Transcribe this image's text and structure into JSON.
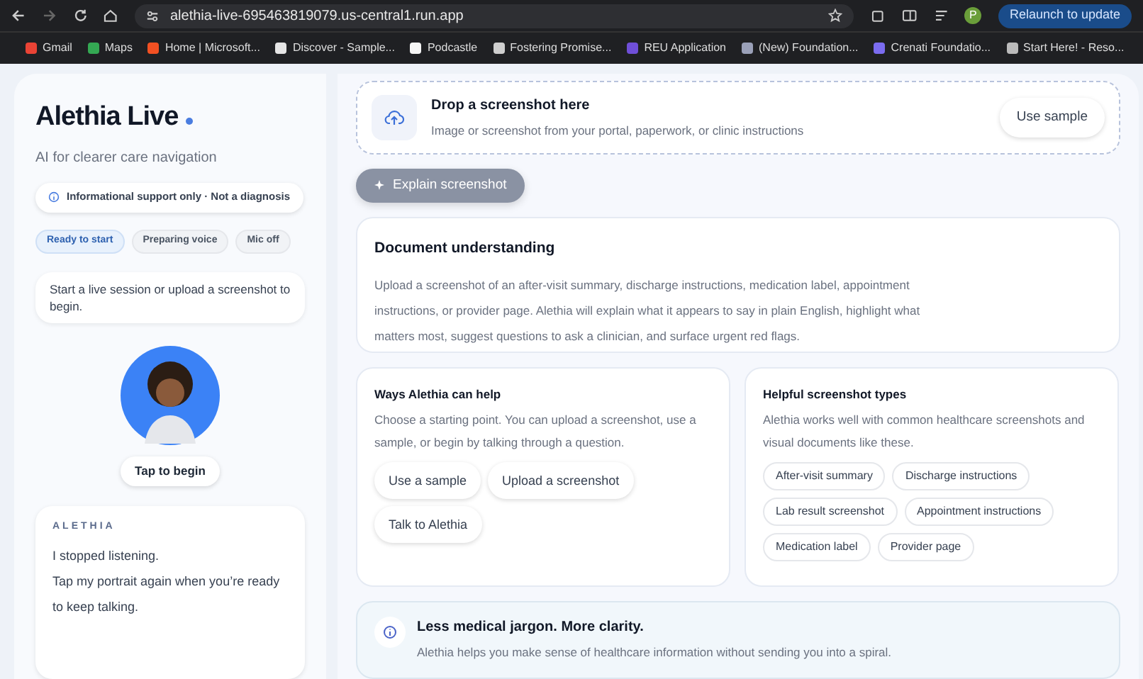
{
  "browser": {
    "url": "alethia-live-695463819079.us-central1.run.app",
    "relaunch_button": "Relaunch to update",
    "profile_initial": "P",
    "bookmarks": [
      {
        "label": "Gmail",
        "color": "#ea4335"
      },
      {
        "label": "Maps",
        "color": "#34a853"
      },
      {
        "label": "Home | Microsoft...",
        "color": "#f25022"
      },
      {
        "label": "Discover - Sample...",
        "color": "#e5e5e5"
      },
      {
        "label": "Podcastle",
        "color": "#f5f5f5"
      },
      {
        "label": "Fostering Promise...",
        "color": "#cfcfcf"
      },
      {
        "label": "REU Application",
        "color": "#6f4fd8"
      },
      {
        "label": "(New) Foundation...",
        "color": "#9aa0b8"
      },
      {
        "label": "Crenati Foundatio...",
        "color": "#7b6cf0"
      },
      {
        "label": "Start Here! - Reso...",
        "color": "#bbbbbb"
      }
    ]
  },
  "sidebar": {
    "title": "Alethia Live",
    "subtitle": "AI for clearer care navigation",
    "notice": "Informational support only · Not a diagnosis",
    "statuses": [
      {
        "label": "Ready to start",
        "selected": true
      },
      {
        "label": "Preparing voice",
        "selected": false
      },
      {
        "label": "Mic off",
        "selected": false
      }
    ],
    "message": "Start a live session or upload a screenshot to begin.",
    "tap_button": "Tap to begin",
    "transcript": {
      "speaker": "ALETHIA",
      "lines": [
        "I stopped listening.",
        "Tap my portrait again when you’re ready to keep talking."
      ]
    }
  },
  "dropzone": {
    "title": "Drop a screenshot here",
    "subtitle": "Image or screenshot from your portal, paperwork, or clinic instructions",
    "button": "Use sample"
  },
  "explain_button": {
    "label": "Explain screenshot",
    "disabled": true
  },
  "document_card": {
    "title": "Document understanding",
    "body": "Upload a screenshot of an after-visit summary, discharge instructions, medication label, appointment instructions, or provider page. Alethia will explain what it appears to say in plain English, highlight what matters most, suggest questions to ask a clinician, and surface urgent red flags."
  },
  "ways_card": {
    "title": "Ways Alethia can help",
    "body": "Choose a starting point. You can upload a screenshot, use a sample, or begin by talking through a question.",
    "actions": [
      "Use a sample",
      "Upload a screenshot",
      "Talk to Alethia"
    ]
  },
  "types_card": {
    "title": "Helpful screenshot types",
    "body": "Alethia works well with common healthcare screenshots and visual documents like these.",
    "tags": [
      "After-visit summary",
      "Discharge instructions",
      "Lab result screenshot",
      "Appointment instructions",
      "Medication label",
      "Provider page"
    ]
  },
  "clarity_card": {
    "title": "Less medical jargon. More clarity.",
    "body": "Alethia helps you make sense of healthcare information without sending you into a spiral."
  }
}
